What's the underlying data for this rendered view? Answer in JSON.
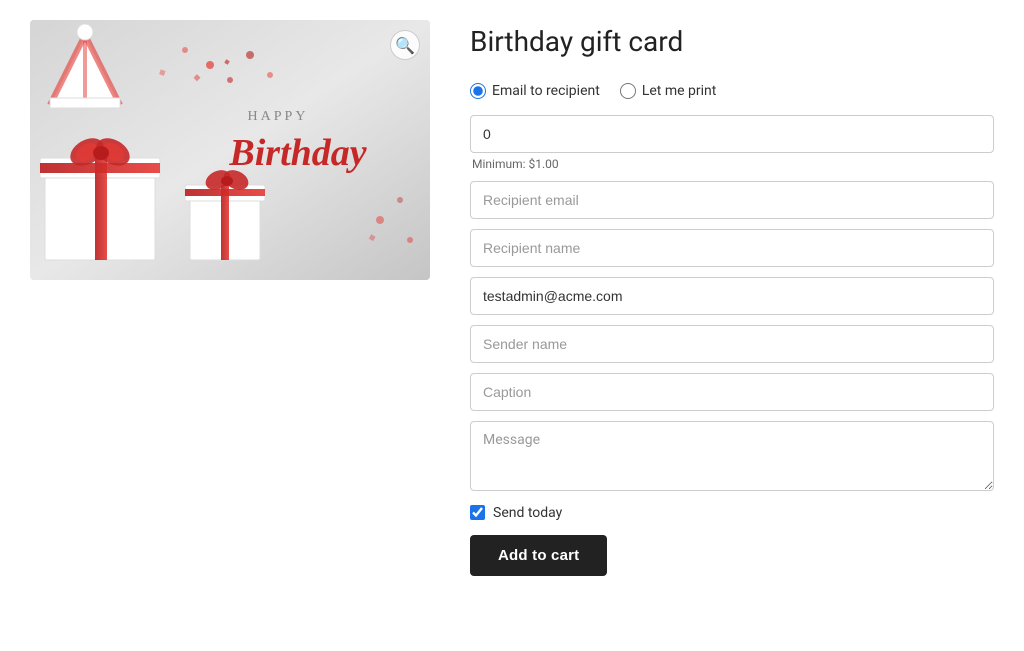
{
  "product": {
    "title": "Birthday gift card",
    "image_alt": "Birthday gift card image"
  },
  "delivery": {
    "option1_label": "Email to recipient",
    "option2_label": "Let me print",
    "selected": "email"
  },
  "form": {
    "amount_value": "0",
    "amount_placeholder": "0",
    "min_label": "Minimum: $1.00",
    "recipient_email_placeholder": "Recipient email",
    "recipient_name_placeholder": "Recipient name",
    "sender_email_value": "testadmin@acme.com",
    "sender_name_placeholder": "Sender name",
    "caption_placeholder": "Caption",
    "message_placeholder": "Message",
    "send_today_label": "Send today",
    "send_today_checked": true
  },
  "actions": {
    "add_to_cart_label": "Add to cart",
    "zoom_icon": "🔍"
  }
}
